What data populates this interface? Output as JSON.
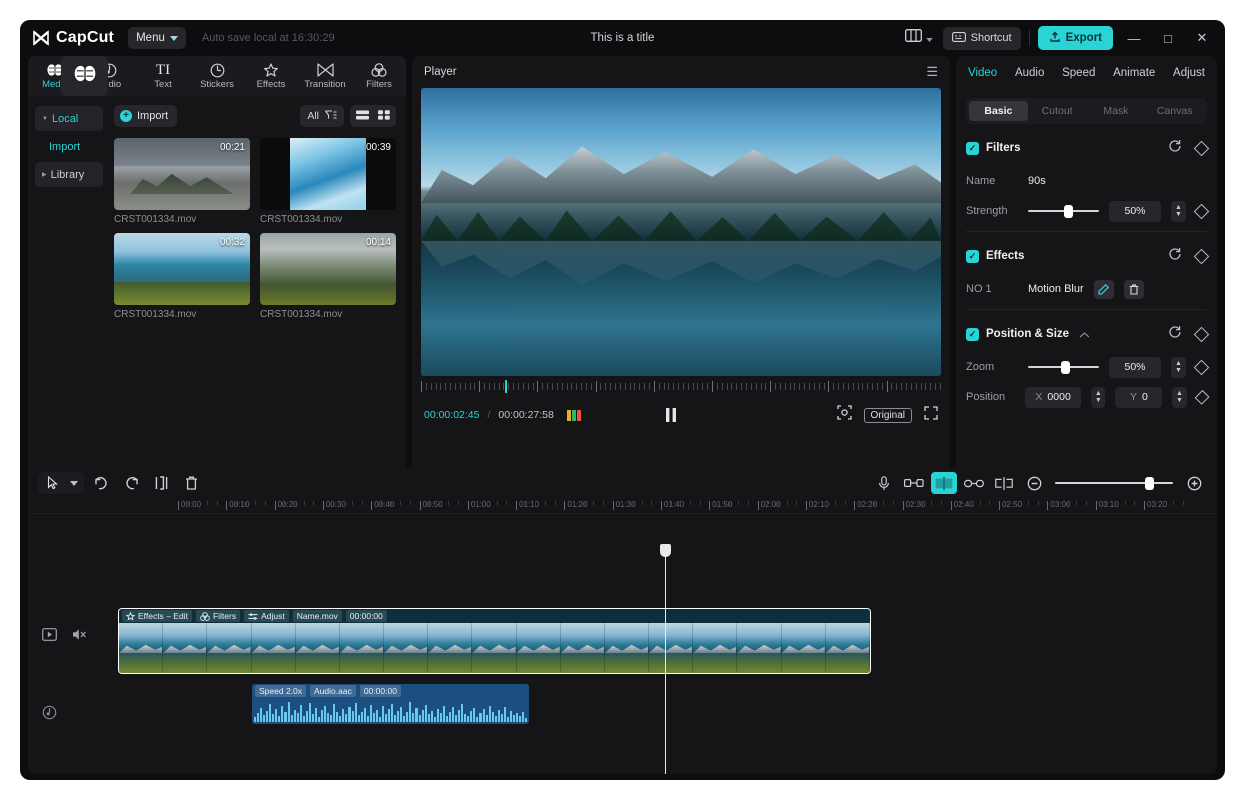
{
  "titlebar": {
    "app_name": "CapCut",
    "menu_label": "Menu",
    "autosave": "Auto save local at 16:30:29",
    "doc_title": "This is a title",
    "shortcut_label": "Shortcut",
    "export_label": "Export",
    "minimize": "—",
    "maximize": "□",
    "close": "✕"
  },
  "left_panel": {
    "tabs": [
      {
        "label": "Media",
        "icon": "brain-icon",
        "active": true
      },
      {
        "label": "Audio",
        "icon": "audio-note-icon",
        "active": false
      },
      {
        "label": "Text",
        "icon": "text-ti-icon",
        "active": false
      },
      {
        "label": "Stickers",
        "icon": "clock-sticker-icon",
        "active": false
      },
      {
        "label": "Effects",
        "icon": "sparkle-icon",
        "active": false
      },
      {
        "label": "Transition",
        "icon": "bowtie-icon",
        "active": false
      },
      {
        "label": "Filters",
        "icon": "three-circles-icon",
        "active": false
      }
    ],
    "subnav": [
      {
        "label": "Local",
        "selected": true
      },
      {
        "label": "Import",
        "selected": false
      },
      {
        "label": "Library",
        "selected": false
      }
    ],
    "import_button": "Import",
    "filter_label": "All",
    "media_items": [
      {
        "name": "CRST001334.mov",
        "duration": "00:21"
      },
      {
        "name": "CRST001334.mov",
        "duration": "00:39"
      },
      {
        "name": "CRST001334.mov",
        "duration": "00:32"
      },
      {
        "name": "CRST001334.mov",
        "duration": "00:14"
      }
    ]
  },
  "player": {
    "title": "Player",
    "current_time": "00:00:02:45",
    "separator": "/",
    "total_time": "00:00:27:58",
    "scale_label": "Original"
  },
  "right_panel": {
    "tabs": [
      {
        "label": "Video",
        "active": true
      },
      {
        "label": "Audio",
        "active": false
      },
      {
        "label": "Speed",
        "active": false
      },
      {
        "label": "Animate",
        "active": false
      },
      {
        "label": "Adjust",
        "active": false
      }
    ],
    "segments": [
      {
        "label": "Basic",
        "on": true
      },
      {
        "label": "Cutout",
        "on": false
      },
      {
        "label": "Mask",
        "on": false
      },
      {
        "label": "Canvas",
        "on": false
      }
    ],
    "filters": {
      "title": "Filters",
      "name_label": "Name",
      "name_value": "90s",
      "strength_label": "Strength",
      "strength_value": "50%",
      "strength_pct": 50
    },
    "effects": {
      "title": "Effects",
      "item_no": "NO 1",
      "item_name": "Motion Blur"
    },
    "position_size": {
      "title": "Position & Size",
      "zoom_label": "Zoom",
      "zoom_value": "50%",
      "zoom_pct": 50,
      "position_label": "Position",
      "x_label": "X",
      "x_value": "0000",
      "y_label": "Y",
      "y_value": "0"
    }
  },
  "timeline": {
    "ruler_ticks": [
      "00:00",
      "00:10",
      "00:20",
      "00:30",
      "00:40",
      "00:50",
      "01:00",
      "01:10",
      "01:20",
      "01:30",
      "01:40",
      "01:50",
      "02:00",
      "02:10",
      "02:20",
      "02:30",
      "02:40",
      "02:50",
      "03:00",
      "03:10",
      "03:20"
    ],
    "video_clip": {
      "effects_label": "Effects – Edit",
      "filters_label": "Filters",
      "adjust_label": "Adjust",
      "name": "Name.mov",
      "time": "00:00:00"
    },
    "audio_clip": {
      "speed_label": "Speed 2.0x",
      "name": "Audio.aac",
      "time": "00:00:00"
    }
  },
  "colors": {
    "accent": "#2ad4d4",
    "panel": "#151518",
    "background": "#0d0d0f",
    "video_clip": "#123744",
    "audio_clip": "#1b4f80"
  }
}
